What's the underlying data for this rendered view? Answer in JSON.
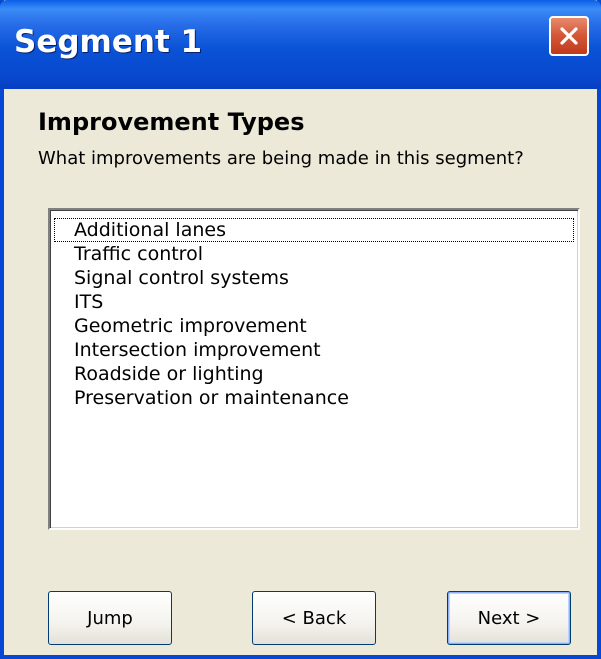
{
  "window": {
    "title": "Segment 1"
  },
  "dialog": {
    "heading": "Improvement Types",
    "question": "What improvements are being made in this segment?"
  },
  "list": {
    "items": [
      "Additional lanes",
      "Traffic control",
      "Signal control systems",
      "ITS",
      "Geometric improvement",
      "Intersection improvement",
      "Roadside or lighting",
      "Preservation or maintenance"
    ],
    "focused_index": 0
  },
  "buttons": {
    "jump": "Jump",
    "back": "< Back",
    "next": "Next >"
  },
  "icons": {
    "close": "close-icon"
  },
  "colors": {
    "titlebar": "#0a52d6",
    "face": "#ece9d8",
    "close": "#c0391b"
  }
}
